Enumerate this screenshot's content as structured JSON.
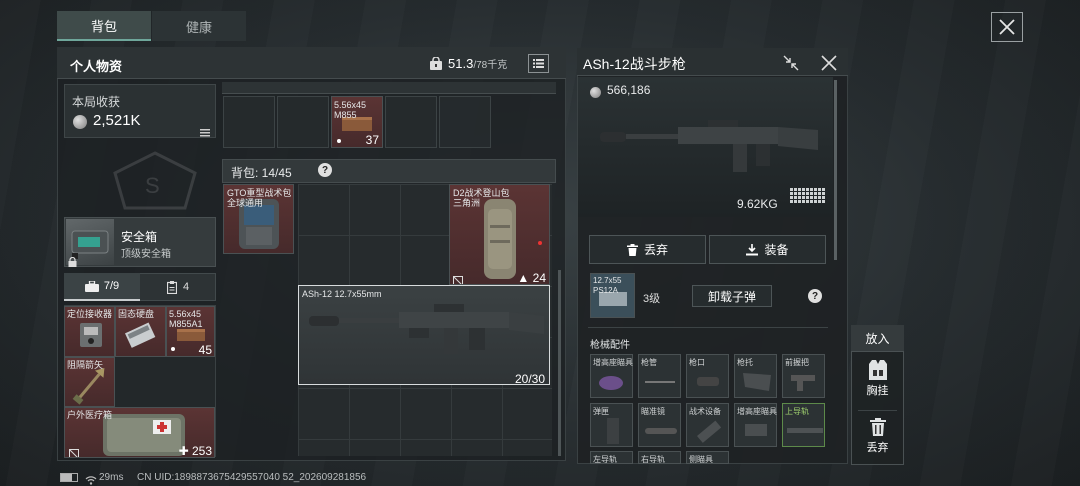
{
  "tabs": [
    {
      "label": "背包",
      "active": true
    },
    {
      "label": "健康",
      "active": false
    }
  ],
  "left": {
    "title": "个人物资",
    "weight_value": "51.3",
    "weight_cap": "/78千克",
    "harvest_label": "本局收获",
    "harvest_value": "2,521K",
    "safebox_title": "安全箱",
    "safebox_sub": "顶级安全箱",
    "pouch_count": "7/9",
    "pouch_count2": "4",
    "pouch_items": [
      {
        "label": "定位接收器"
      },
      {
        "label": "固态硬盘"
      },
      {
        "label": "5.56x45 M855A1",
        "count": "45"
      },
      {
        "label": "阻隔箭矢"
      },
      {
        "label": "户外医疗箱",
        "count": "253"
      }
    ]
  },
  "mid": {
    "top_item_label": "5.56x45 M855",
    "top_item_count": "37",
    "backpack_label": "背包: 14/45",
    "help": "?",
    "items": [
      {
        "label": "GTO重型战术包 全球通用"
      },
      {
        "label": "D2战术登山包 三角洲",
        "count": "24"
      },
      {
        "label": "ASh-12 12.7x55mm",
        "count": "20/30"
      }
    ]
  },
  "detail": {
    "title": "ASh-12战斗步枪",
    "price": "566,186",
    "weight": "9.62KG",
    "discard": "丢弃",
    "equip": "装备",
    "ammo_label": "12.7x55 PS12A",
    "ammo_level": "3级",
    "unload": "卸载子弹",
    "help": "?",
    "attachments_title": "枪械配件",
    "attachment_slots": [
      "增高座瞄具",
      "枪管",
      "枪口",
      "枪托",
      "前握把",
      "弹匣",
      "瞄准镜",
      "战术设备",
      "增高座瞄具",
      "上导轨",
      "左导轨",
      "右导轨",
      "侧瞄具"
    ]
  },
  "side": {
    "title": "放入",
    "chest": "胸挂",
    "discard": "丢弃"
  },
  "status": {
    "ping": "29ms",
    "uid": "CN UID:1898873675429557040 52_202609281856"
  }
}
